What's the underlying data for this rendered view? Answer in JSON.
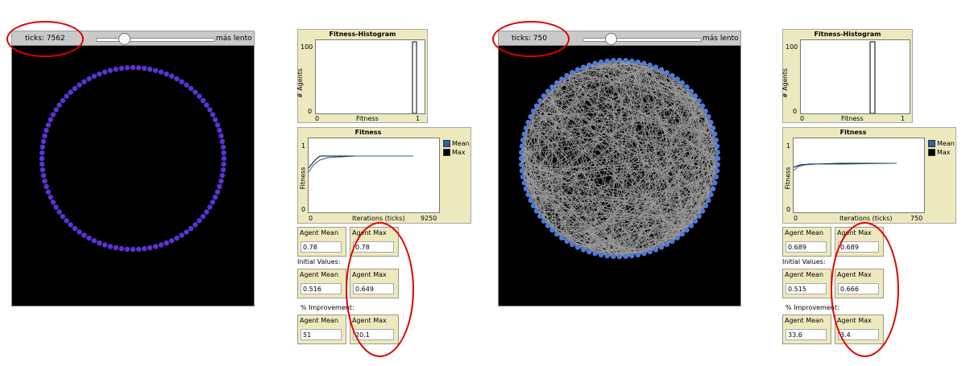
{
  "panels": [
    {
      "ticks": "ticks: 7562",
      "speed": "más lento",
      "histogram": {
        "title": "Fitness-Histogram",
        "ylabel": "# Agents",
        "xlabel": "Fitness",
        "ytop": "100",
        "ybottom": "0",
        "xleft": "0",
        "xright": "1"
      },
      "fitness": {
        "title": "Fitness",
        "ylabel": "Fitness",
        "xlabel": "Iterations (ticks)",
        "ytop": "1",
        "ybottom": "0",
        "xleft": "0",
        "xright": "9250"
      },
      "legend": {
        "mean": "Mean",
        "max": "Max"
      },
      "current": {
        "mean_label": "Agent Mean",
        "mean": "0.78",
        "max_label": "Agent Max",
        "max": "0.78"
      },
      "initial_label": "Initial Values:",
      "initial": {
        "mean_label": "Agent Mean",
        "mean": "0.516",
        "max_label": "Agent Max",
        "max": "0.649"
      },
      "improvement_label": "% Improvement:",
      "improvement": {
        "mean_label": "Agent Mean",
        "mean": "51",
        "max_label": "Agent Max",
        "max": "20.1"
      }
    },
    {
      "ticks": "ticks: 750",
      "speed": "más lento",
      "histogram": {
        "title": "Fitness-Histogram",
        "ylabel": "# Agents",
        "xlabel": "Fitness",
        "ytop": "100",
        "ybottom": "0",
        "xleft": "0",
        "xright": "1"
      },
      "fitness": {
        "title": "Fitness",
        "ylabel": "Fitness",
        "xlabel": "Iterations (ticks)",
        "ytop": "1",
        "ybottom": "0",
        "xleft": "0",
        "xright": "750"
      },
      "legend": {
        "mean": "Mean",
        "max": "Max"
      },
      "current": {
        "mean_label": "Agent Mean",
        "mean": "0.689",
        "max_label": "Agent Max",
        "max": "0.689"
      },
      "initial_label": "Initial Values:",
      "initial": {
        "mean_label": "Agent Mean",
        "mean": "0.515",
        "max_label": "Agent Max",
        "max": "0.666"
      },
      "improvement_label": "% Improvement:",
      "improvement": {
        "mean_label": "Agent Mean",
        "mean": "33.6",
        "max_label": "Agent Max",
        "max": "3.4"
      }
    }
  ],
  "colors": {
    "node_left": "#5a34d6",
    "node_right": "#4f7ad6",
    "edges": "#9a9a9a",
    "mean_series": "#2f5da8",
    "max_series": "#000000",
    "highlight": "#e00000"
  }
}
